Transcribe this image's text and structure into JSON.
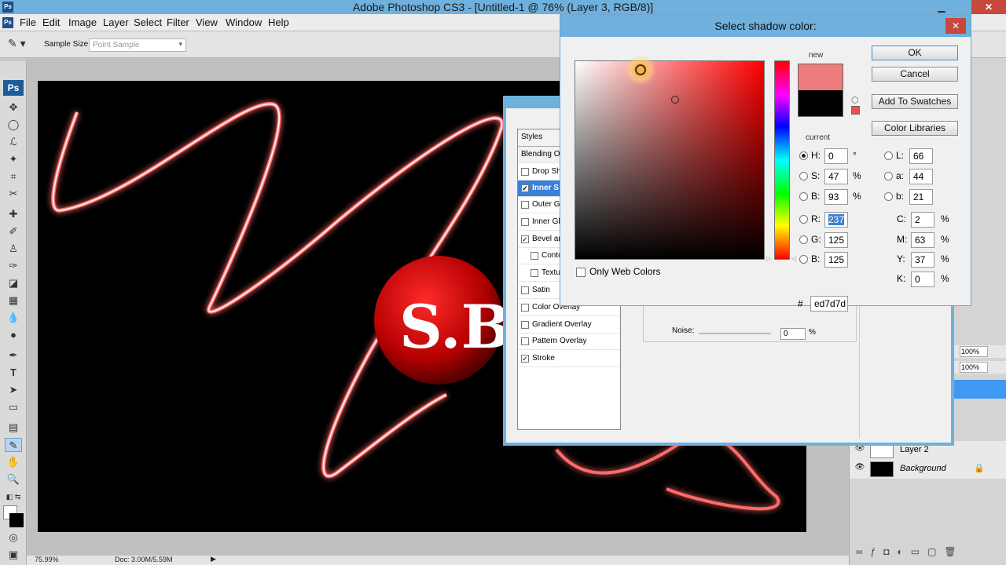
{
  "app": {
    "title": "Adobe Photoshop CS3 - [Untitled-1 @ 76% (Layer 3, RGB/8)]",
    "logo": "Ps",
    "close_glyph": "✕"
  },
  "menu": [
    "File",
    "Edit",
    "Image",
    "Layer",
    "Select",
    "Filter",
    "View",
    "Window",
    "Help"
  ],
  "options_bar": {
    "sample_size_label": "Sample Size:",
    "sample_size_value": "Point Sample"
  },
  "canvas": {
    "text": "S.B"
  },
  "status": {
    "zoom": "75.99%",
    "doc": "Doc: 3.00M/5.59M"
  },
  "layers": [
    {
      "name": "Layer 2"
    },
    {
      "name": "Background"
    }
  ],
  "panel_values": {
    "opacity": "100%",
    "fill": "100%"
  },
  "layer_style": {
    "styles_header": "Styles",
    "items": [
      {
        "label": "Blending Op",
        "checked": false,
        "sub": false,
        "header": true
      },
      {
        "label": "Drop Sh",
        "checked": false,
        "sub": false
      },
      {
        "label": "Inner S",
        "checked": true,
        "sub": false,
        "selected": true
      },
      {
        "label": "Outer Gl",
        "checked": false,
        "sub": false
      },
      {
        "label": "Inner Gl",
        "checked": false,
        "sub": false
      },
      {
        "label": "Bevel an",
        "checked": true,
        "sub": false
      },
      {
        "label": "Conto",
        "checked": false,
        "sub": true
      },
      {
        "label": "Textu",
        "checked": false,
        "sub": true
      },
      {
        "label": "Satin",
        "checked": false,
        "sub": false
      },
      {
        "label": "Color Overlay",
        "checked": false,
        "sub": false
      },
      {
        "label": "Gradient Overlay",
        "checked": false,
        "sub": false
      },
      {
        "label": "Pattern Overlay",
        "checked": false,
        "sub": false
      },
      {
        "label": "Stroke",
        "checked": true,
        "sub": false
      }
    ],
    "noise_label": "Noise:",
    "noise_value": "0",
    "noise_unit": "%"
  },
  "color_picker": {
    "title": "Select shadow color:",
    "new_label": "new",
    "current_label": "current",
    "new_color": "#ed7d7d",
    "current_color": "#000000",
    "buttons": {
      "ok": "OK",
      "cancel": "Cancel",
      "add_swatches": "Add To Swatches",
      "color_libraries": "Color Libraries"
    },
    "only_web_colors": "Only Web Colors",
    "hsb": {
      "h": "0",
      "h_unit": "°",
      "s": "47",
      "s_unit": "%",
      "b": "93",
      "b_unit": "%"
    },
    "rgb": {
      "r": "237",
      "g": "125",
      "b": "125"
    },
    "lab": {
      "l": "66",
      "a": "44",
      "b": "21"
    },
    "cmyk": {
      "c": "2",
      "m": "63",
      "y": "37",
      "k": "0",
      "unit": "%"
    },
    "hex_label": "#",
    "hex": "ed7d7d",
    "labels": {
      "h": "H:",
      "s": "S:",
      "b": "B:",
      "r": "R:",
      "g": "G:",
      "b2": "B:",
      "l": "L:",
      "a": "a:",
      "b3": "b:",
      "c": "C:",
      "m": "M:",
      "y": "Y:",
      "k": "K:"
    }
  }
}
